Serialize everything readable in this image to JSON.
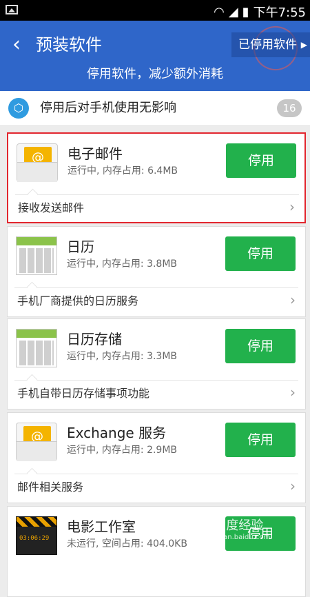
{
  "status_bar": {
    "time": "下午7:55"
  },
  "header": {
    "back_label": "‹",
    "title": "预装软件",
    "disabled_apps_button": "已停用软件",
    "subtitle": "停用软件，减少额外消耗"
  },
  "info_bar": {
    "text": "停用后对手机使用无影响",
    "count": "16"
  },
  "apps": [
    {
      "name": "电子邮件",
      "status": "运行中, 内存占用: 6.4MB",
      "button": "停用",
      "description": "接收发送邮件",
      "icon": "email-envelope-icon"
    },
    {
      "name": "日历",
      "status": "运行中, 内存占用: 3.8MB",
      "button": "停用",
      "description": "手机厂商提供的日历服务",
      "icon": "calendar-icon"
    },
    {
      "name": "日历存储",
      "status": "运行中, 内存占用: 3.3MB",
      "button": "停用",
      "description": "手机自带日历存储事项功能",
      "icon": "calendar-icon"
    },
    {
      "name": "Exchange 服务",
      "status": "运行中, 内存占用: 2.9MB",
      "button": "停用",
      "description": "邮件相关服务",
      "icon": "email-envelope-icon"
    },
    {
      "name": "电影工作室",
      "status": "未运行, 空间占用: 404.0KB",
      "button": "停用",
      "description": "",
      "icon": "clapperboard-icon"
    }
  ],
  "watermark": {
    "text": "Bai度经验",
    "subtext": "jingyan.baidu.com"
  },
  "colors": {
    "header": "#2f66c9",
    "button": "#22b14c",
    "highlight": "#e2262e"
  }
}
